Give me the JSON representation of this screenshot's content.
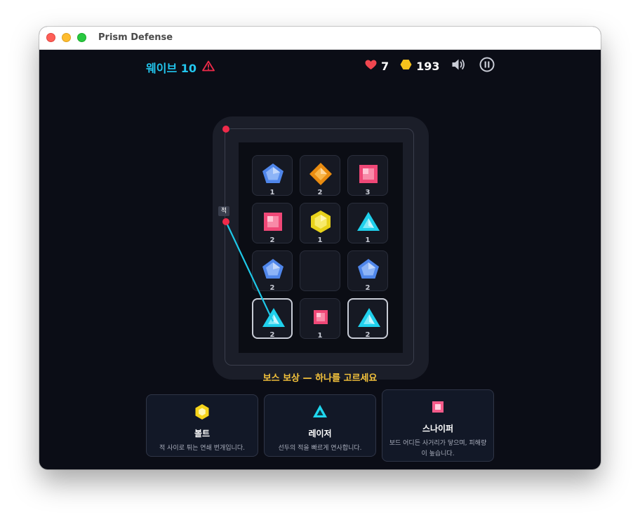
{
  "window": {
    "title": "Prism Defense"
  },
  "hud": {
    "wave_label": "웨이브 10",
    "warning_icon": "warning-triangle-icon",
    "lives": "7",
    "gold": "193",
    "sound_icon": "speaker-icon",
    "pause_icon": "pause-icon"
  },
  "board": {
    "cells": [
      {
        "gem": "pentagon-blue",
        "level": "1"
      },
      {
        "gem": "diamond-orange",
        "level": "2"
      },
      {
        "gem": "square-pink",
        "level": "3"
      },
      {
        "gem": "square-pink",
        "level": "2"
      },
      {
        "gem": "hexagon-yellow",
        "level": "1"
      },
      {
        "gem": "triangle-cyan",
        "level": "1"
      },
      {
        "gem": "pentagon-blue",
        "level": "2"
      },
      {
        "gem": "",
        "level": ""
      },
      {
        "gem": "pentagon-blue",
        "level": "2"
      },
      {
        "gem": "triangle-cyan",
        "level": "2",
        "selected": true
      },
      {
        "gem": "square-pink-small",
        "level": "1"
      },
      {
        "gem": "triangle-cyan",
        "level": "2",
        "selected": true
      }
    ],
    "enemy_label": "적"
  },
  "reward": {
    "title": "보스 보상 — 하나를 고르세요",
    "cards": [
      {
        "icon": "hexagon-yellow-icon",
        "name": "볼트",
        "desc": "적 사이로 튀는 연쇄 번개입니다."
      },
      {
        "icon": "triangle-cyan-icon",
        "name": "레이저",
        "desc": "선두의 적을 빠르게 연사합니다."
      },
      {
        "icon": "square-pink-icon",
        "name": "스나이퍼",
        "desc": "보드 어디든 사거리가 닿으며, 피해량이 높습니다."
      }
    ]
  },
  "colors": {
    "wave": "#22c6ee",
    "reward_title": "#f5c33b",
    "enemy": "#ef2b4a",
    "laser": "#1ec8e8"
  }
}
